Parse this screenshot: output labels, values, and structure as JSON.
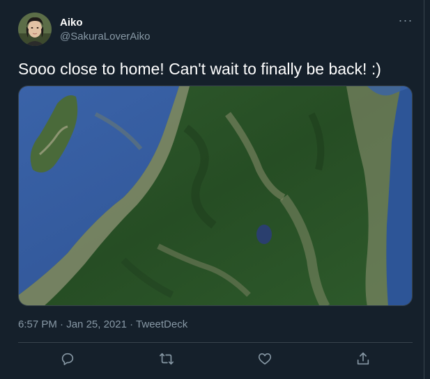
{
  "author": {
    "display_name": "Aiko",
    "handle": "@SakuraLoverAiko"
  },
  "tweet": {
    "text": "Sooo close to home! Can't wait to finally be back! :)",
    "media_alt": "Satellite view of mountainous terrain along a coastline"
  },
  "meta": {
    "time": "6:57 PM",
    "date": "Jan 25, 2021",
    "source": "TweetDeck",
    "separator": " · "
  },
  "actions": {
    "more_glyph": "···"
  },
  "colors": {
    "background": "#15202b",
    "secondary_text": "#8899a6",
    "divider": "#38444d"
  }
}
